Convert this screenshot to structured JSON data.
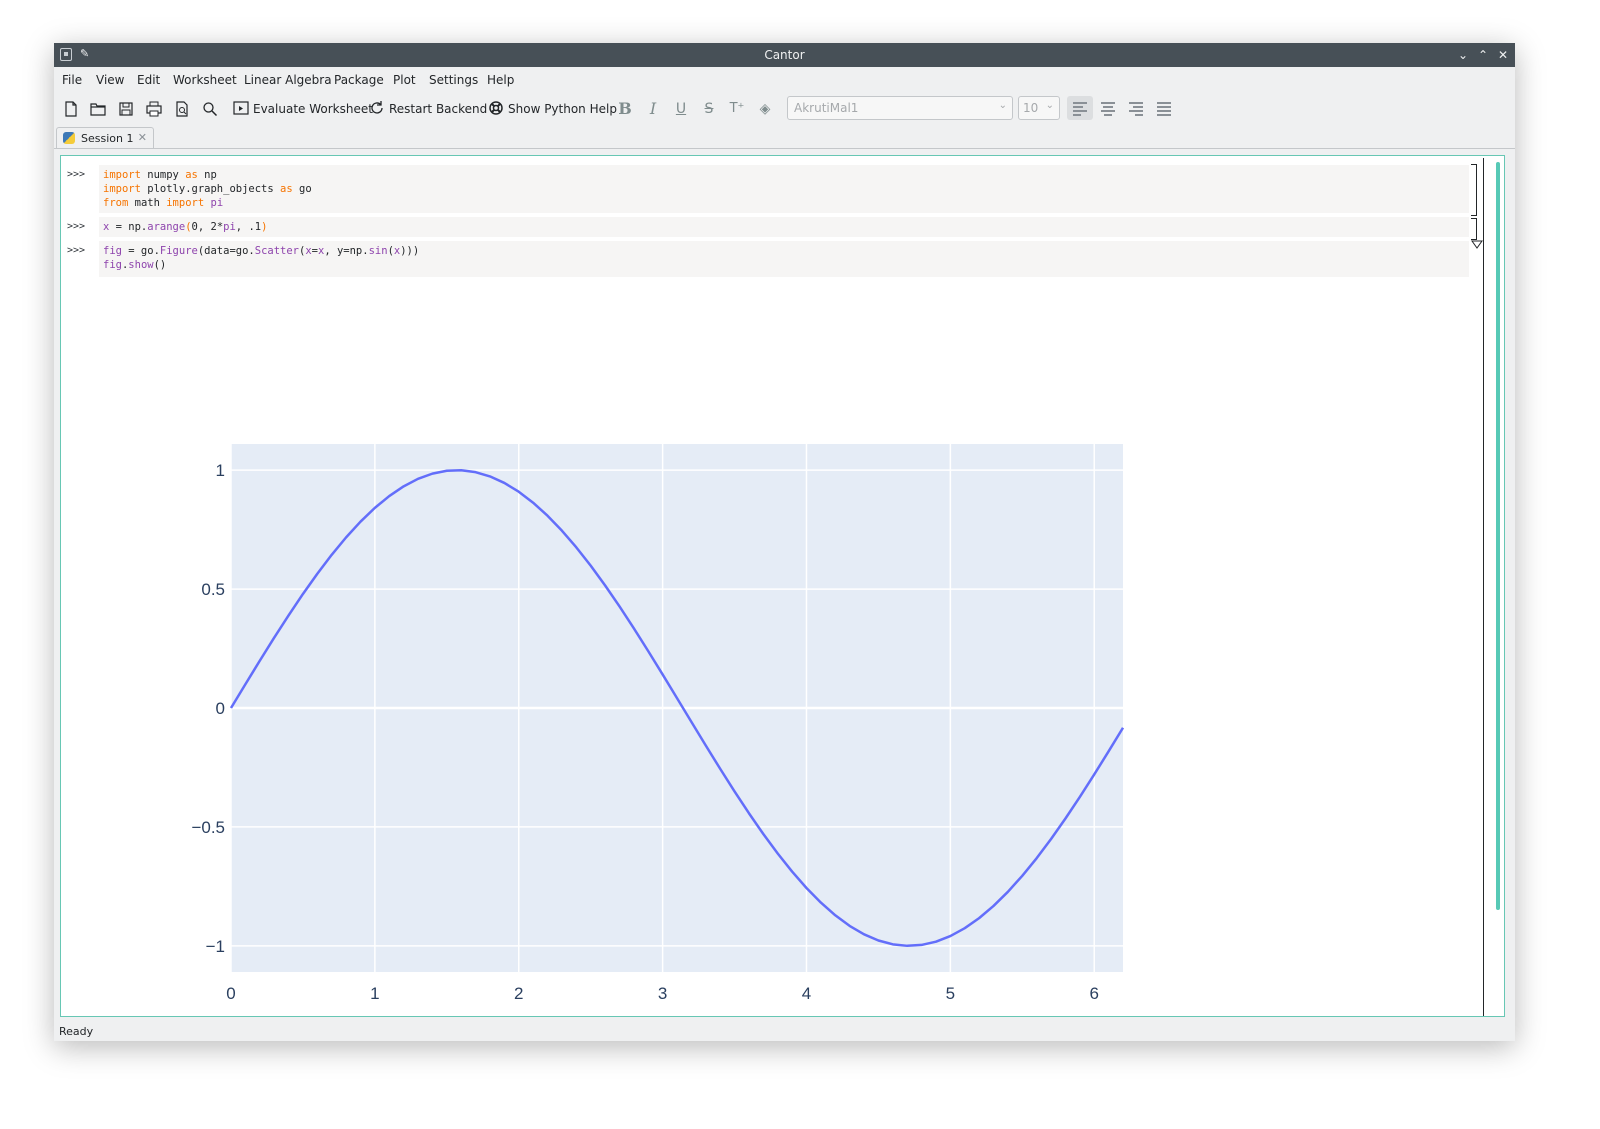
{
  "window": {
    "title": "Cantor"
  },
  "menu": [
    "File",
    "View",
    "Edit",
    "Worksheet",
    "Linear Algebra",
    "Package",
    "Plot",
    "Settings",
    "Help"
  ],
  "toolbar": {
    "evaluate_label": "Evaluate Worksheet",
    "restart_label": "Restart Backend",
    "help_label": "Show Python Help",
    "font_name": "AkrutiMal1",
    "font_size": "10"
  },
  "tab": {
    "label": "Session 1"
  },
  "entries": [
    {
      "prompt": ">>>",
      "lines": [
        "import numpy as np",
        "import plotly.graph_objects as go",
        "from math import pi"
      ]
    },
    {
      "prompt": ">>>",
      "lines": [
        "x = np.arange(0, 2*pi, .1)"
      ]
    },
    {
      "prompt": ">>>",
      "lines": [
        "fig = go.Figure(data=go.Scatter(x=x, y=np.sin(x)))",
        "fig.show()"
      ]
    }
  ],
  "status": "Ready",
  "colors": {
    "plot_bg": "#e5ecf6",
    "line": "#636efa",
    "tick_text": "#2a3f5f",
    "accent": "#57c9b6"
  },
  "chart_data": {
    "type": "line",
    "x": [
      0,
      0.1,
      0.2,
      0.3,
      0.4,
      0.5,
      0.6,
      0.7,
      0.8,
      0.9,
      1.0,
      1.1,
      1.2,
      1.3,
      1.4,
      1.5,
      1.6,
      1.7,
      1.8,
      1.9,
      2.0,
      2.1,
      2.2,
      2.3,
      2.4,
      2.5,
      2.6,
      2.7,
      2.8,
      2.9,
      3.0,
      3.1,
      3.2,
      3.3,
      3.4,
      3.5,
      3.6,
      3.7,
      3.8,
      3.9,
      4.0,
      4.1,
      4.2,
      4.3,
      4.4,
      4.5,
      4.6,
      4.7,
      4.8,
      4.9,
      5.0,
      5.1,
      5.2,
      5.3,
      5.4,
      5.5,
      5.6,
      5.7,
      5.8,
      5.9,
      6.0,
      6.1,
      6.2
    ],
    "series": [
      {
        "values": [
          0,
          0.0998,
          0.1987,
          0.2955,
          0.3894,
          0.4794,
          0.5646,
          0.6442,
          0.7174,
          0.7833,
          0.8415,
          0.8912,
          0.932,
          0.9636,
          0.9854,
          0.9975,
          0.9996,
          0.9917,
          0.9738,
          0.9463,
          0.9093,
          0.8632,
          0.8085,
          0.7457,
          0.6755,
          0.5985,
          0.5155,
          0.4274,
          0.335,
          0.2392,
          0.1411,
          0.0416,
          -0.0584,
          -0.1577,
          -0.2555,
          -0.3508,
          -0.4425,
          -0.5298,
          -0.6119,
          -0.6878,
          -0.7568,
          -0.8183,
          -0.8716,
          -0.9162,
          -0.9516,
          -0.9775,
          -0.9937,
          -0.9999,
          -0.9962,
          -0.9825,
          -0.9589,
          -0.9258,
          -0.8835,
          -0.8323,
          -0.7728,
          -0.7055,
          -0.6313,
          -0.5507,
          -0.4646,
          -0.3739,
          -0.2794,
          -0.1822,
          -0.0831
        ]
      }
    ],
    "x_ticks": [
      "0",
      "1",
      "2",
      "3",
      "4",
      "5",
      "6"
    ],
    "y_ticks": [
      "1",
      "0.5",
      "0",
      "−0.5",
      "−1"
    ],
    "y_tick_values": [
      1,
      0.5,
      0,
      -0.5,
      -1
    ],
    "xlim": [
      0,
      6.2
    ],
    "ylim": [
      -1.11,
      1.11
    ],
    "grid": true
  }
}
